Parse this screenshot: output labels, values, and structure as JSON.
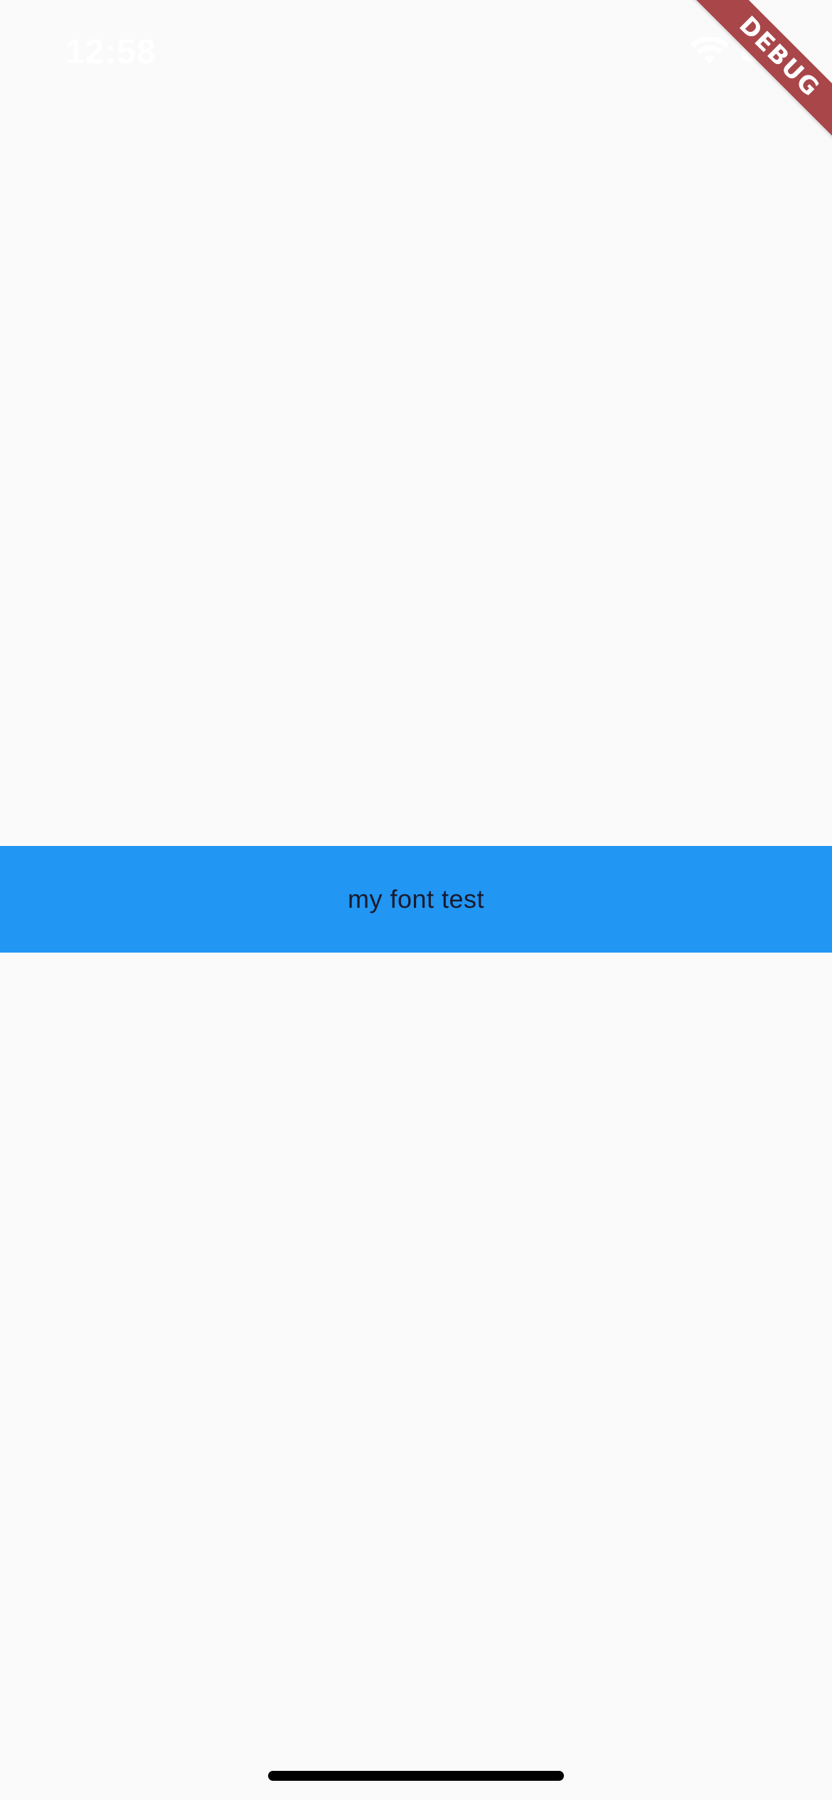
{
  "status_bar": {
    "time": "12:58",
    "wifi_icon": "wifi-icon",
    "battery_icon": "battery-icon"
  },
  "debug_banner": {
    "label": "DEBUG"
  },
  "main": {
    "text": "my font test",
    "background_color": "#2196f3",
    "text_color": "#1a1a2e"
  },
  "colors": {
    "page_background": "#fafafa",
    "banner": "#a8464a"
  }
}
